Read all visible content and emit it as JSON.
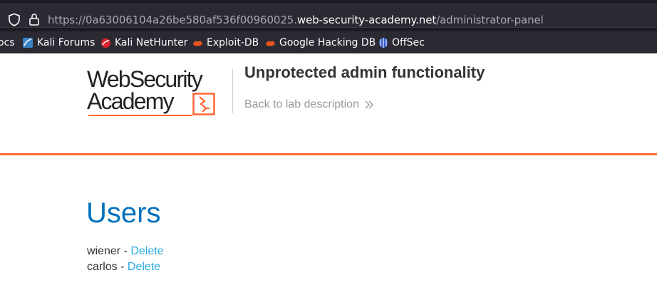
{
  "browser": {
    "url_prefix": "https://0a63006104a26be580af536f00960025.",
    "url_domain": "web-security-academy.net",
    "url_path": "/administrator-panel",
    "bookmarks": [
      {
        "label": "ocs",
        "icon": "none"
      },
      {
        "label": "Kali Forums",
        "icon": "kali-forums-icon"
      },
      {
        "label": "Kali NetHunter",
        "icon": "kali-nethunter-icon"
      },
      {
        "label": "Exploit-DB",
        "icon": "exploit-db-icon"
      },
      {
        "label": "Google Hacking DB",
        "icon": "ghdb-icon"
      },
      {
        "label": "OffSec",
        "icon": "offsec-icon"
      }
    ]
  },
  "header": {
    "logo_line1": "WebSecurity",
    "logo_line2": "Academy",
    "lab_title": "Unprotected admin functionality",
    "back_link": "Back to lab description"
  },
  "main": {
    "heading": "Users",
    "users": [
      {
        "name": "wiener",
        "separator": " - ",
        "action": "Delete"
      },
      {
        "name": "carlos",
        "separator": " - ",
        "action": "Delete"
      }
    ]
  },
  "colors": {
    "accent": "#ff6633",
    "heading": "#0071bc",
    "link": "#29abe0"
  }
}
